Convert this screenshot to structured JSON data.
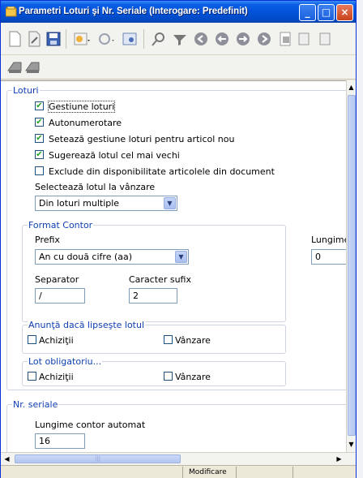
{
  "window": {
    "title": "Parametri Loturi  şi Nr. Seriale (Interogare: Predefinit)"
  },
  "title_buttons": {
    "minimize": "_",
    "maximize": "□",
    "close": "×"
  },
  "toolbar": {
    "icons": [
      "new-document-icon",
      "edit-document-icon",
      "save-icon",
      "properties-icon",
      "refresh-icon",
      "settings-icon",
      "find-icon",
      "filter-icon",
      "first-record-icon",
      "previous-record-icon",
      "next-record-icon",
      "last-record-icon",
      "print-icon",
      "report-icon",
      "export-icon"
    ]
  },
  "loturi": {
    "legend": "Loturi",
    "checks": [
      {
        "label": "Gestiune loturi",
        "checked": true
      },
      {
        "label": "Autonumerotare",
        "checked": true
      },
      {
        "label": "Setează gestiune loturi pentru articol nou",
        "checked": true
      },
      {
        "label": "Sugerează lotul cel mai vechi",
        "checked": true
      },
      {
        "label": "Exclude din disponibilitate articolele din document",
        "checked": false
      }
    ],
    "select_lot_label": "Selectează lotul la vânzare",
    "select_lot_value": "Din loturi multiple",
    "format": {
      "legend": "Format Contor",
      "prefix_label": "Prefix",
      "prefix_value": "An cu două cifre (aa)",
      "length_label": "Lungime",
      "length_value": "0",
      "separator_label": "Separator",
      "separator_value": "/",
      "suffix_label": "Caracter sufix",
      "suffix_value": "2"
    },
    "missing": {
      "legend": "Anunţă dacă lipseşte lotul",
      "achizitii": "Achiziţii",
      "vanzare": "Vânzare"
    },
    "mandatory": {
      "legend": "Lot obligatoriu...",
      "achizitii": "Achiziţii",
      "vanzare": "Vânzare"
    }
  },
  "serials": {
    "legend": "Nr. seriale",
    "counter_label": "Lungime contor automat",
    "counter_value": "16"
  },
  "status": {
    "mode": "Modificare"
  },
  "check_mark": "✔"
}
